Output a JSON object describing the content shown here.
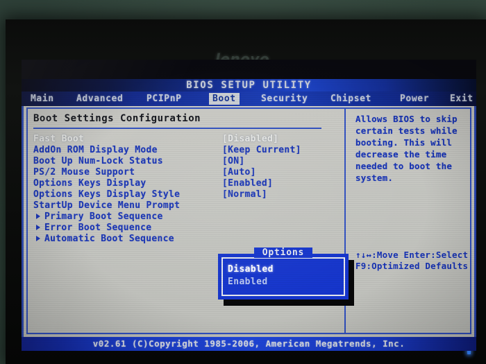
{
  "device": {
    "brand_logo": "lenovo",
    "power_led": "power-led-indicator"
  },
  "bios": {
    "title": "BIOS SETUP UTILITY",
    "menu": [
      {
        "label": "Main",
        "active": false
      },
      {
        "label": "Advanced",
        "active": false
      },
      {
        "label": "PCIPnP",
        "active": false
      },
      {
        "label": "Boot",
        "active": true
      },
      {
        "label": "Security",
        "active": false
      },
      {
        "label": "Chipset",
        "active": false
      },
      {
        "label": "Power",
        "active": false
      },
      {
        "label": "Exit",
        "active": false
      }
    ],
    "section_title": "Boot Settings Configuration",
    "settings": [
      {
        "label": "Fast Boot",
        "value": "[Disabled]",
        "selected": true,
        "submenu": false
      },
      {
        "label": "AddOn ROM Display Mode",
        "value": "[Keep Current]",
        "selected": false,
        "submenu": false
      },
      {
        "label": "Boot Up Num-Lock Status",
        "value": "[ON]",
        "selected": false,
        "submenu": false
      },
      {
        "label": "PS/2 Mouse Support",
        "value": "[Auto]",
        "selected": false,
        "submenu": false
      },
      {
        "label": "Options Keys Display",
        "value": "[Enabled]",
        "selected": false,
        "submenu": false
      },
      {
        "label": "Options Keys Display Style",
        "value": "[Normal]",
        "selected": false,
        "submenu": false
      },
      {
        "label": "StartUp Device Menu Prompt",
        "value": "",
        "selected": false,
        "submenu": false
      },
      {
        "label": "Primary Boot Sequence",
        "value": "",
        "selected": false,
        "submenu": true
      },
      {
        "label": "Error Boot Sequence",
        "value": "",
        "selected": false,
        "submenu": true
      },
      {
        "label": "Automatic Boot Sequence",
        "value": "",
        "selected": false,
        "submenu": true
      }
    ],
    "popup": {
      "title": "Options",
      "options": [
        {
          "label": "Disabled",
          "selected": true
        },
        {
          "label": "Enabled",
          "selected": false
        }
      ]
    },
    "help": {
      "lines": [
        "Allows BIOS to skip",
        "certain tests while",
        "booting. This will",
        "decrease the time",
        "needed to boot the",
        "system."
      ]
    },
    "legend": {
      "lines": [
        "↑↓↔:Move  Enter:Select",
        "F9:Optimized Defaults"
      ]
    },
    "footer": "v02.61 (C)Copyright 1985-2006, American Megatrends, Inc.",
    "colors": {
      "accent_blue": "#1632b4",
      "title_blue": "#1a3cb4",
      "popup_blue": "#1535cc",
      "screen_bg": "#c4c5c0",
      "highlight_text": "#e6e7e4"
    }
  }
}
